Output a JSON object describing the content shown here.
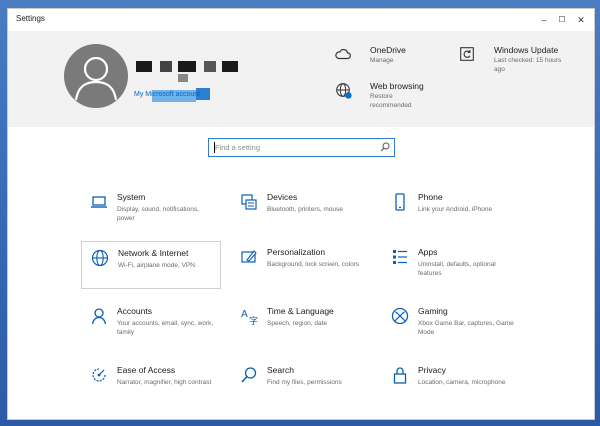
{
  "window": {
    "title": "Settings"
  },
  "controls": {
    "minimize": "–",
    "maximize": "☐",
    "close": "✕"
  },
  "user": {
    "link": "My Microsoft account"
  },
  "quick": [
    {
      "id": "onedrive",
      "icon": "cloud-icon",
      "title": "OneDrive",
      "sub": [
        "Manage"
      ]
    },
    {
      "id": "windows-update",
      "icon": "refresh-icon",
      "title": "Windows Update",
      "sub": [
        "Last checked: 15 hours",
        "ago"
      ]
    },
    {
      "id": "web-browsing",
      "icon": "globe-icon",
      "title": "Web browsing",
      "sub": [
        "Restore",
        "recommended"
      ]
    }
  ],
  "search": {
    "placeholder": "Find a setting"
  },
  "categories": [
    {
      "id": "system",
      "icon": "laptop-icon",
      "title": "System",
      "desc": "Display, sound, notifications, power"
    },
    {
      "id": "devices",
      "icon": "keyboard-icon",
      "title": "Devices",
      "desc": "Bluetooth, printers, mouse"
    },
    {
      "id": "phone",
      "icon": "phone-icon",
      "title": "Phone",
      "desc": "Link your Android, iPhone"
    },
    {
      "id": "network",
      "icon": "globe-icon",
      "title": "Network & Internet",
      "desc": "Wi-Fi, airplane mode, VPN"
    },
    {
      "id": "personalization",
      "icon": "paintbrush-icon",
      "title": "Personalization",
      "desc": "Background, lock screen, colors"
    },
    {
      "id": "apps",
      "icon": "apps-list-icon",
      "title": "Apps",
      "desc": "Uninstall, defaults, optional features"
    },
    {
      "id": "accounts",
      "icon": "person-icon",
      "title": "Accounts",
      "desc": "Your accounts, email, sync, work, family"
    },
    {
      "id": "time-language",
      "icon": "language-icon",
      "title": "Time & Language",
      "desc": "Speech, region, date"
    },
    {
      "id": "gaming",
      "icon": "xbox-icon",
      "title": "Gaming",
      "desc": "Xbox Game Bar, captures, Game Mode"
    },
    {
      "id": "ease-of-access",
      "icon": "ease-of-access-icon",
      "title": "Ease of Access",
      "desc": "Narrator, magnifier, high contrast"
    },
    {
      "id": "search",
      "icon": "search-icon",
      "title": "Search",
      "desc": "Find my files, permissions"
    },
    {
      "id": "privacy",
      "icon": "lock-icon",
      "title": "Privacy",
      "desc": "Location, camera, microphone"
    }
  ]
}
